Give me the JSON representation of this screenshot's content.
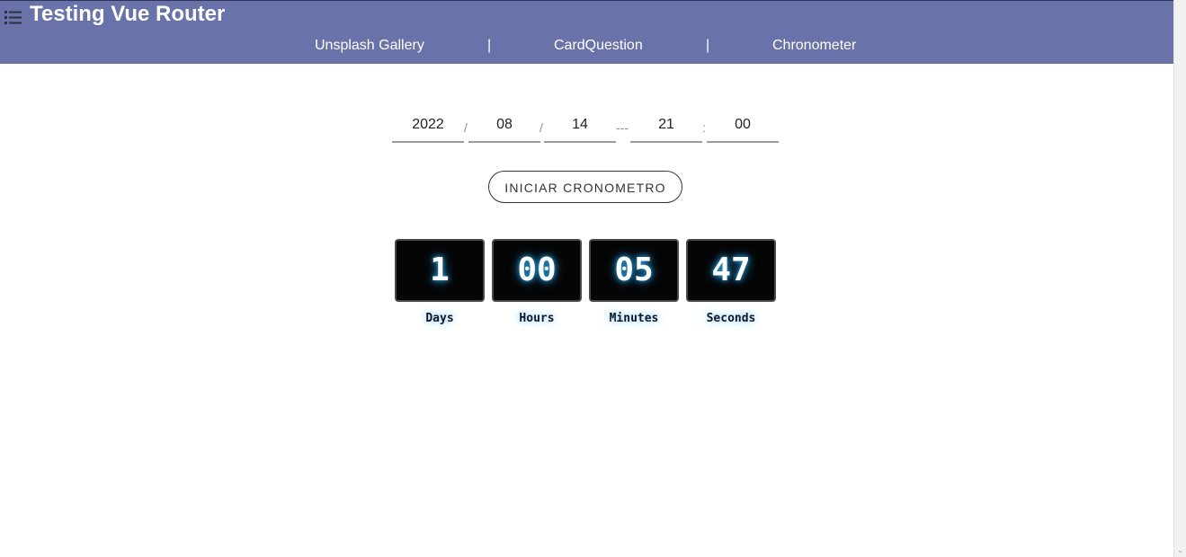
{
  "header": {
    "title": "Testing Vue Router",
    "menu_icon": "list-icon",
    "nav": [
      {
        "label": "Unsplash Gallery"
      },
      {
        "label": "CardQuestion"
      },
      {
        "label": "Chronometer"
      }
    ],
    "separator": "|",
    "background": "#6973a9"
  },
  "datetime": {
    "year": "2022",
    "month": "08",
    "day": "14",
    "hour": "21",
    "minute": "00",
    "sep_date": "/",
    "sep_datetime": "---",
    "sep_time": ":"
  },
  "start_button": {
    "label": "INICIAR CRONOMETRO"
  },
  "countdown": [
    {
      "value": "1",
      "label": "Days"
    },
    {
      "value": "00",
      "label": "Hours"
    },
    {
      "value": "05",
      "label": "Minutes"
    },
    {
      "value": "47",
      "label": "Seconds"
    }
  ],
  "colors": {
    "tile_bg": "#050505",
    "glow": "#29a8e0"
  }
}
